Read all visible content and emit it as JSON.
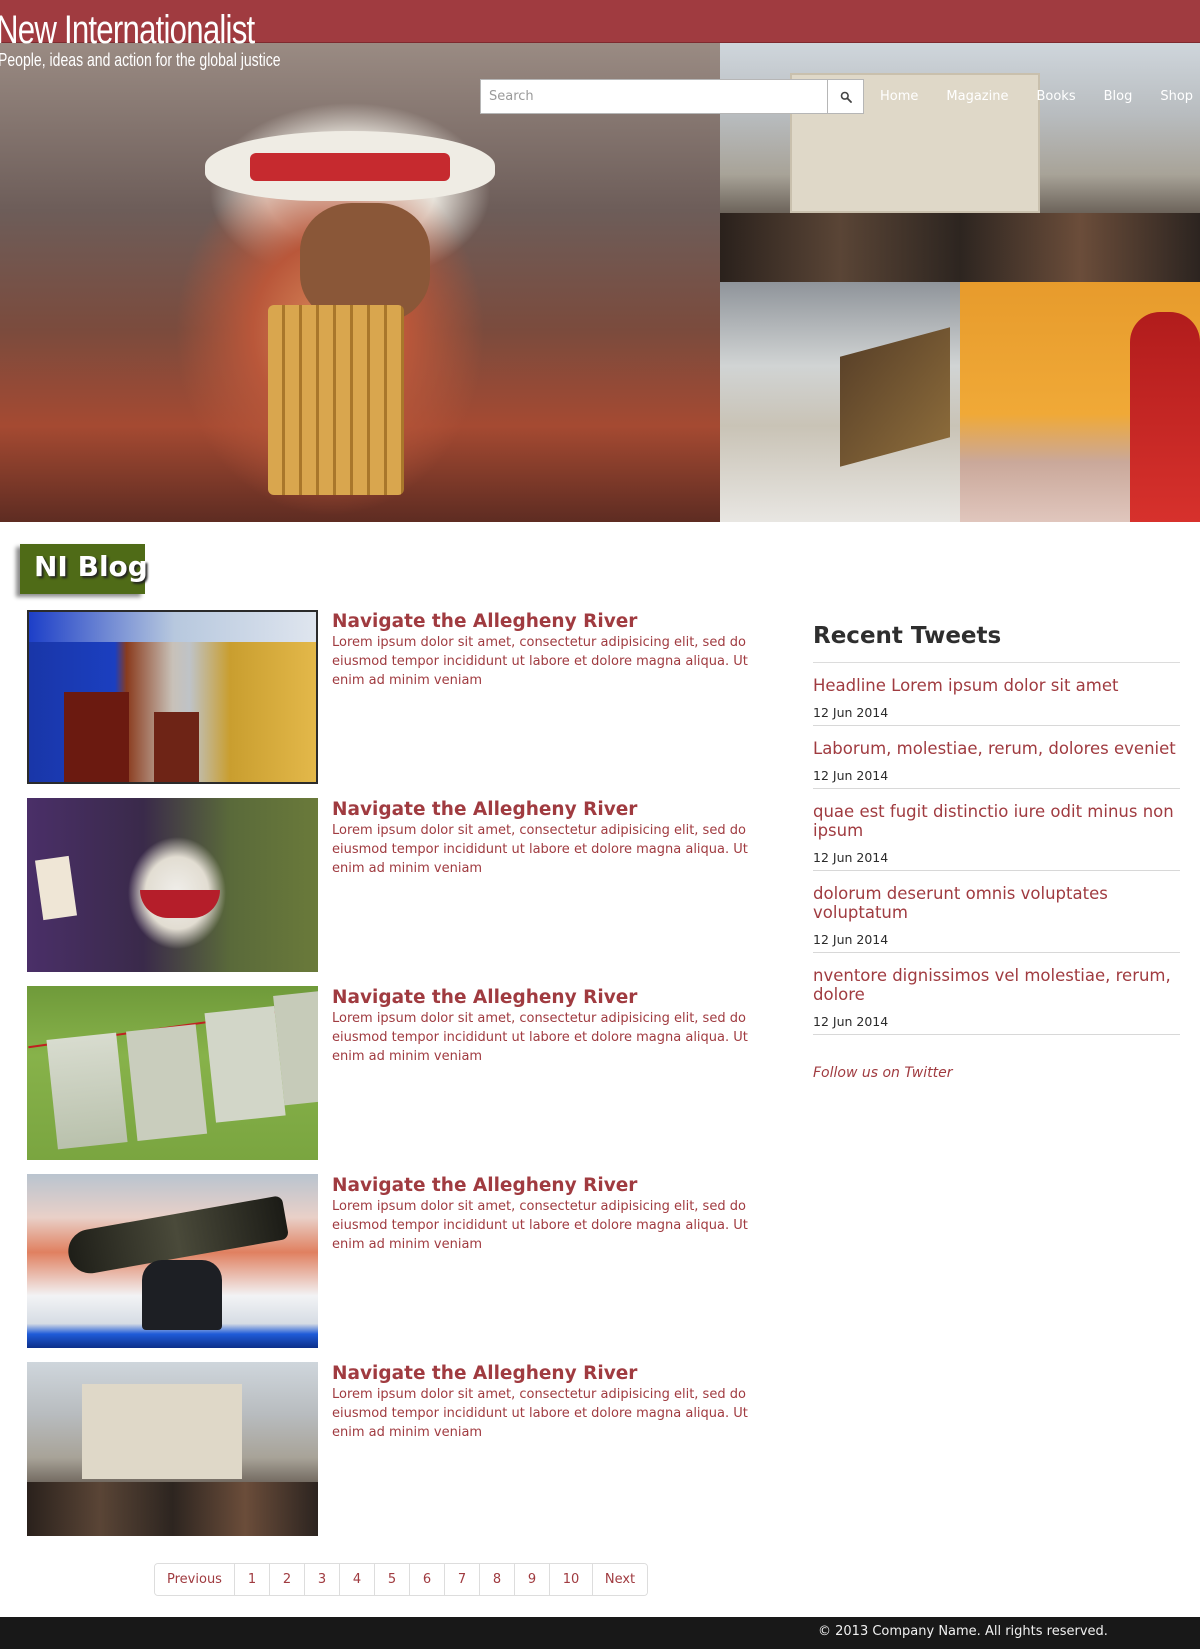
{
  "header": {
    "brand_title": "New Internationalist",
    "brand_tagline": "People, ideas and action for the global justice"
  },
  "search": {
    "placeholder": "Search"
  },
  "nav": {
    "items": [
      "Home",
      "Magazine",
      "Books",
      "Blog",
      "Shop"
    ]
  },
  "section": {
    "title": "NI Blog"
  },
  "articles": [
    {
      "title": "Navigate the Allegheny River",
      "excerpt": "Lorem ipsum dolor sit amet, consectetur adipisicing elit, sed do eiusmod tempor incididunt ut labore et dolore magna aliqua. Ut enim ad minim veniam"
    },
    {
      "title": "Navigate the Allegheny River",
      "excerpt": "Lorem ipsum dolor sit amet, consectetur adipisicing elit, sed do eiusmod tempor incididunt ut labore et dolore magna aliqua. Ut enim ad minim veniam"
    },
    {
      "title": "Navigate the Allegheny River",
      "excerpt": "Lorem ipsum dolor sit amet, consectetur adipisicing elit, sed do eiusmod tempor incididunt ut labore et dolore magna aliqua. Ut enim ad minim veniam"
    },
    {
      "title": "Navigate the Allegheny River",
      "excerpt": "Lorem ipsum dolor sit amet, consectetur adipisicing elit, sed do eiusmod tempor incididunt ut labore et dolore magna aliqua. Ut enim ad minim veniam"
    },
    {
      "title": "Navigate the Allegheny River",
      "excerpt": "Lorem ipsum dolor sit amet, consectetur adipisicing elit, sed do eiusmod tempor incididunt ut labore et dolore magna aliqua. Ut enim ad minim veniam"
    }
  ],
  "pagination": {
    "previous": "Previous",
    "pages": [
      "1",
      "2",
      "3",
      "4",
      "5",
      "6",
      "7",
      "8",
      "9",
      "10"
    ],
    "next": "Next"
  },
  "sidebar": {
    "heading": "Recent Tweets",
    "tweets": [
      {
        "title": "Headline Lorem ipsum dolor sit amet",
        "date": "12 Jun 2014"
      },
      {
        "title": "Laborum, molestiae, rerum, dolores eveniet",
        "date": "12 Jun 2014"
      },
      {
        "title": "quae est fugit distinctio iure odit minus non ipsum",
        "date": "12 Jun 2014"
      },
      {
        "title": "dolorum deserunt omnis voluptates voluptatum",
        "date": "12 Jun 2014"
      },
      {
        "title": "nventore dignissimos vel molestiae, rerum, dolore",
        "date": "12 Jun 2014"
      }
    ],
    "follow": "Follow us on Twitter"
  },
  "footer": {
    "copyright": "© 2013 Company Name. All rights reserved."
  },
  "colors": {
    "brand": "#a03b40",
    "badge": "#4f6b17",
    "footer": "#181818"
  },
  "icons": {
    "search_button": "search-icon"
  }
}
